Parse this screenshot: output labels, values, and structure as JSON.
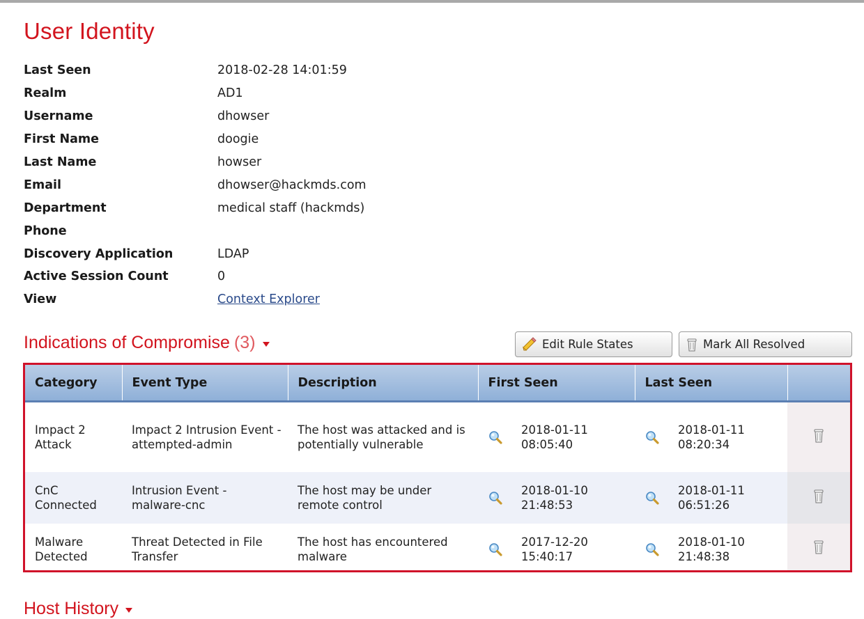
{
  "user_identity": {
    "title": "User Identity",
    "fields": [
      {
        "label": "Last Seen",
        "value": "2018-02-28 14:01:59"
      },
      {
        "label": "Realm",
        "value": "AD1"
      },
      {
        "label": "Username",
        "value": "dhowser"
      },
      {
        "label": "First Name",
        "value": "doogie"
      },
      {
        "label": "Last Name",
        "value": "howser"
      },
      {
        "label": "Email",
        "value": "dhowser@hackmds.com"
      },
      {
        "label": "Department",
        "value": "medical staff (hackmds)"
      },
      {
        "label": "Phone",
        "value": ""
      },
      {
        "label": "Discovery Application",
        "value": "LDAP"
      },
      {
        "label": "Active Session Count",
        "value": "0"
      },
      {
        "label": "View",
        "value": "Context Explorer"
      }
    ]
  },
  "ioc": {
    "title": "Indications of Compromise",
    "count": "(3)",
    "buttons": {
      "edit": "Edit Rule States",
      "mark": "Mark All Resolved"
    },
    "columns": [
      "Category",
      "Event Type",
      "Description",
      "First Seen",
      "Last Seen"
    ],
    "rows": [
      {
        "category": "Impact 2 Attack",
        "event_type": "Impact 2 Intrusion Event - attempted-admin",
        "description": "The host was attacked and is potentially vulnerable",
        "first_date": "2018-01-11",
        "first_time": "08:05:40",
        "last_date": "2018-01-11",
        "last_time": "08:20:34"
      },
      {
        "category": "CnC Connected",
        "event_type": "Intrusion Event - malware-cnc",
        "description": "The host may be under remote control",
        "first_date": "2018-01-10",
        "first_time": "21:48:53",
        "last_date": "2018-01-11",
        "last_time": "06:51:26"
      },
      {
        "category": "Malware Detected",
        "event_type": "Threat Detected in File Transfer",
        "description": "The host has encountered malware",
        "first_date": "2017-12-20",
        "first_time": "15:40:17",
        "last_date": "2018-01-10",
        "last_time": "21:48:38"
      }
    ]
  },
  "host_history": {
    "title": "Host History"
  },
  "colors": {
    "accent_red": "#d2141e",
    "header_blue": "#8fb0d8",
    "link": "#2a4a8a"
  },
  "icons": {
    "edit": "pencil-icon",
    "mark": "trash-icon",
    "search": "magnifier-icon",
    "dropdown": "caret-down-icon"
  }
}
